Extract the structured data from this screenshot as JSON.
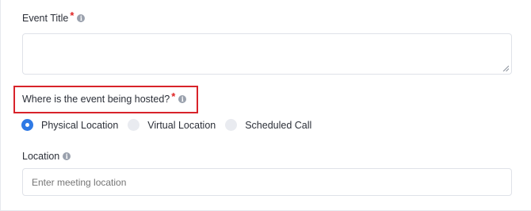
{
  "event_title": {
    "label": "Event Title",
    "required_mark": "*",
    "info_icon": "i",
    "value": ""
  },
  "hosting": {
    "label": "Where is the event being hosted?",
    "required_mark": "*",
    "info_icon": "i",
    "options": [
      {
        "label": "Physical Location",
        "selected": true
      },
      {
        "label": "Virtual Location",
        "selected": false
      },
      {
        "label": "Scheduled Call",
        "selected": false
      }
    ],
    "highlight_color": "#d8232a"
  },
  "location": {
    "label": "Location",
    "info_icon": "i",
    "placeholder": "Enter meeting location",
    "value": ""
  },
  "colors": {
    "accent": "#2f7ae5",
    "required": "#e02424"
  }
}
